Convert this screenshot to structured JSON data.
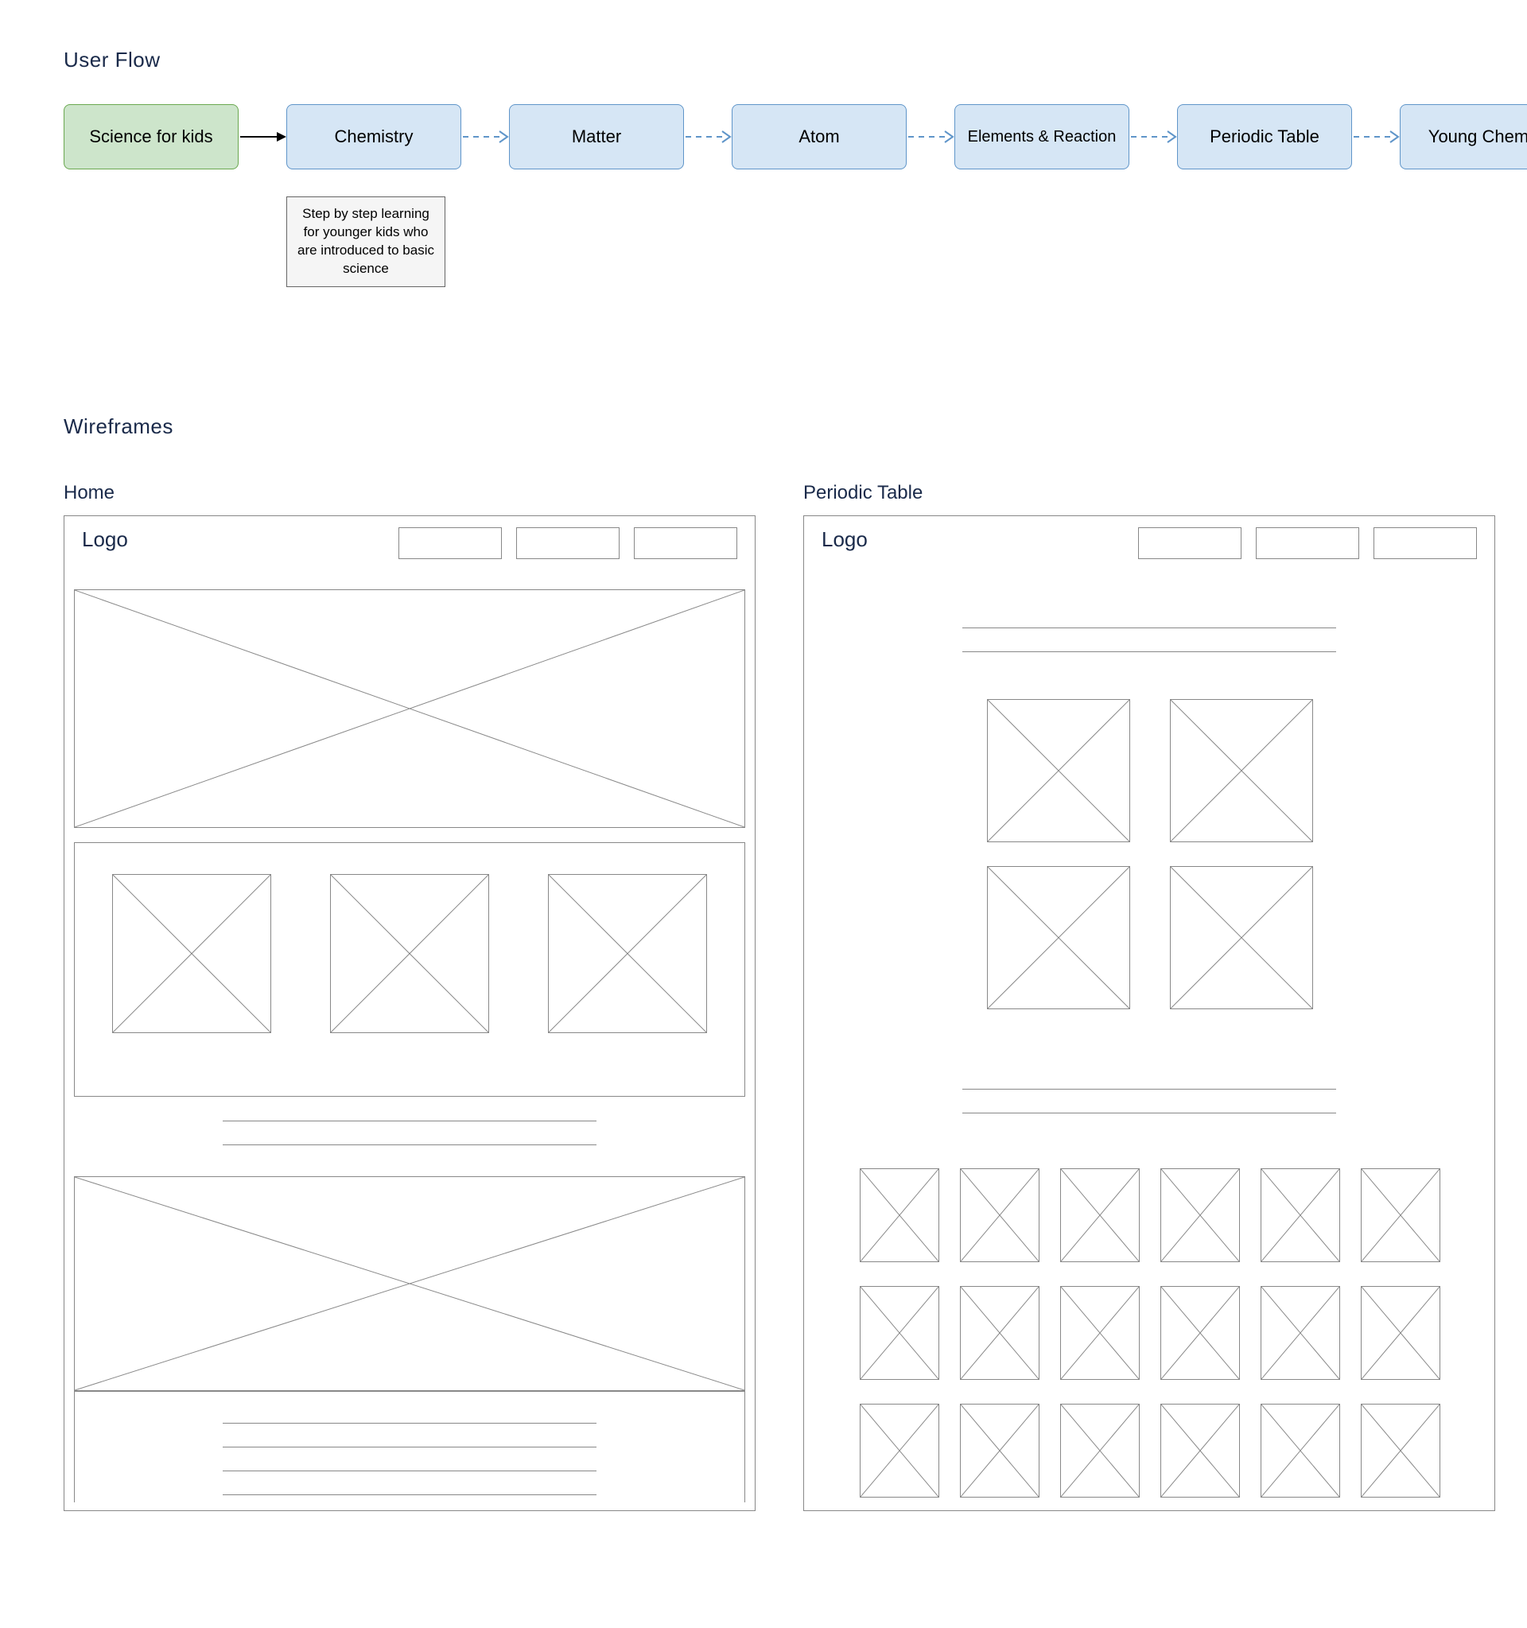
{
  "sections": {
    "user_flow_title": "User Flow",
    "wireframes_title": "Wireframes"
  },
  "flow": {
    "start": "Science for kids",
    "steps": [
      "Chemistry",
      "Matter",
      "Atom",
      "Elements & Reaction",
      "Periodic Table",
      "Young Chemist"
    ],
    "note": "Step by step learning for younger kids who are introduced to basic science",
    "arrow_style": {
      "start_to_first": "solid-black",
      "between_steps": "dashed-blue-open-arrow"
    }
  },
  "wireframes": {
    "home": {
      "title": "Home",
      "logo_text": "Logo",
      "nav_item_count": 3,
      "blocks": [
        {
          "kind": "hero-image"
        },
        {
          "kind": "three-card-row",
          "cards": 3
        },
        {
          "kind": "text-lines",
          "lines": 2
        },
        {
          "kind": "wide-image"
        },
        {
          "kind": "text-lines",
          "lines": 4
        }
      ]
    },
    "periodic_table": {
      "title": "Periodic Table",
      "logo_text": "Logo",
      "nav_item_count": 3,
      "blocks": [
        {
          "kind": "text-lines",
          "lines": 2
        },
        {
          "kind": "two-by-two-grid",
          "items": 4
        },
        {
          "kind": "text-lines",
          "lines": 2
        },
        {
          "kind": "six-col-grid",
          "rows": 3,
          "cols": 6,
          "items": 18
        }
      ]
    }
  }
}
